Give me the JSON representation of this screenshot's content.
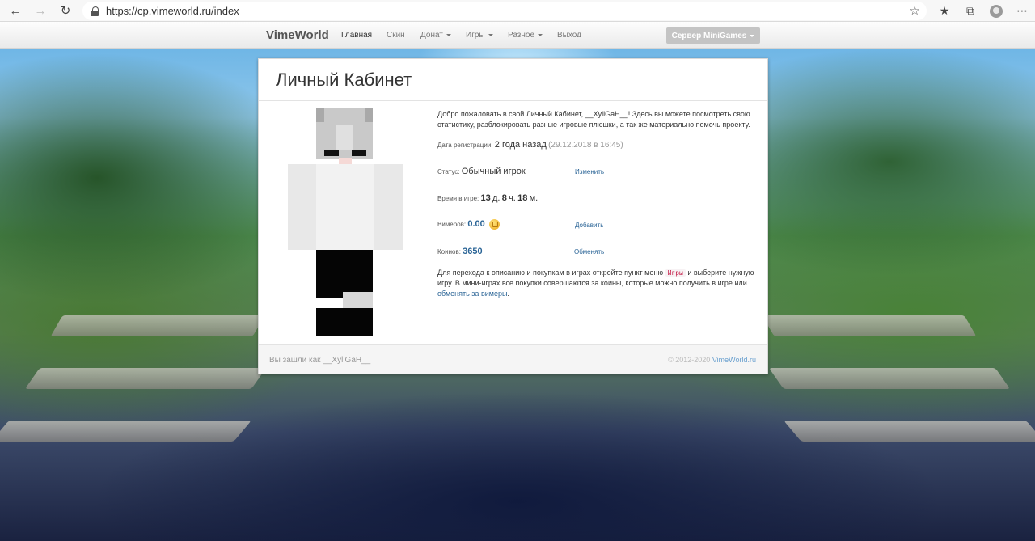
{
  "browser": {
    "url": "https://cp.vimeworld.ru/index"
  },
  "nav": {
    "brand": "VimeWorld",
    "items": [
      {
        "label": "Главная",
        "active": true,
        "dropdown": false
      },
      {
        "label": "Скин",
        "active": false,
        "dropdown": false
      },
      {
        "label": "Донат",
        "active": false,
        "dropdown": true
      },
      {
        "label": "Игры",
        "active": false,
        "dropdown": true
      },
      {
        "label": "Разное",
        "active": false,
        "dropdown": true
      },
      {
        "label": "Выход",
        "active": false,
        "dropdown": false
      }
    ],
    "server_button": "Сервер MiniGames"
  },
  "panel": {
    "title": "Личный Кабинет",
    "welcome_pre": "Добро пожаловать в свой Личный Кабинет, ",
    "username": "__XyllGaH__",
    "welcome_post": "! Здесь вы можете посмотреть свою статистику, разблокировать разные игровые плюшки, а так же материально помочь проекту.",
    "registration_label": "Дата регистрации:",
    "registration_value": "2 года назад",
    "registration_date": "(29.12.2018 в 16:45)",
    "status_label": "Статус:",
    "status_value": "Обычный игрок",
    "status_action": "Изменить",
    "playtime_label": "Время в игре:",
    "playtime_days": "13",
    "playtime_days_unit": "д.",
    "playtime_hours": "8",
    "playtime_hours_unit": "ч.",
    "playtime_minutes": "18",
    "playtime_minutes_unit": "м.",
    "vimers_label": "Вимеров:",
    "vimers_value": "0.00",
    "vimers_action": "Добавить",
    "coins_label": "Коинов:",
    "coins_value": "3650",
    "coins_action": "Обменять",
    "info_pre": "Для перехода к описанию и покупкам в играх откройте пункт меню ",
    "info_code": "Игры",
    "info_mid": " и выберите нужную игру. В мини-играх все покупки совершаются за коины, которые можно получить в игре или ",
    "info_link": "обменять за вимеры",
    "info_post": "."
  },
  "footer": {
    "logged_in_as": "Вы зашли как __XyllGaH__",
    "copyright": "© 2012-2020 ",
    "copyright_link": "VimeWorld.ru"
  },
  "colors": {
    "link": "#2a6496",
    "server_button": "#c4c4c4"
  }
}
